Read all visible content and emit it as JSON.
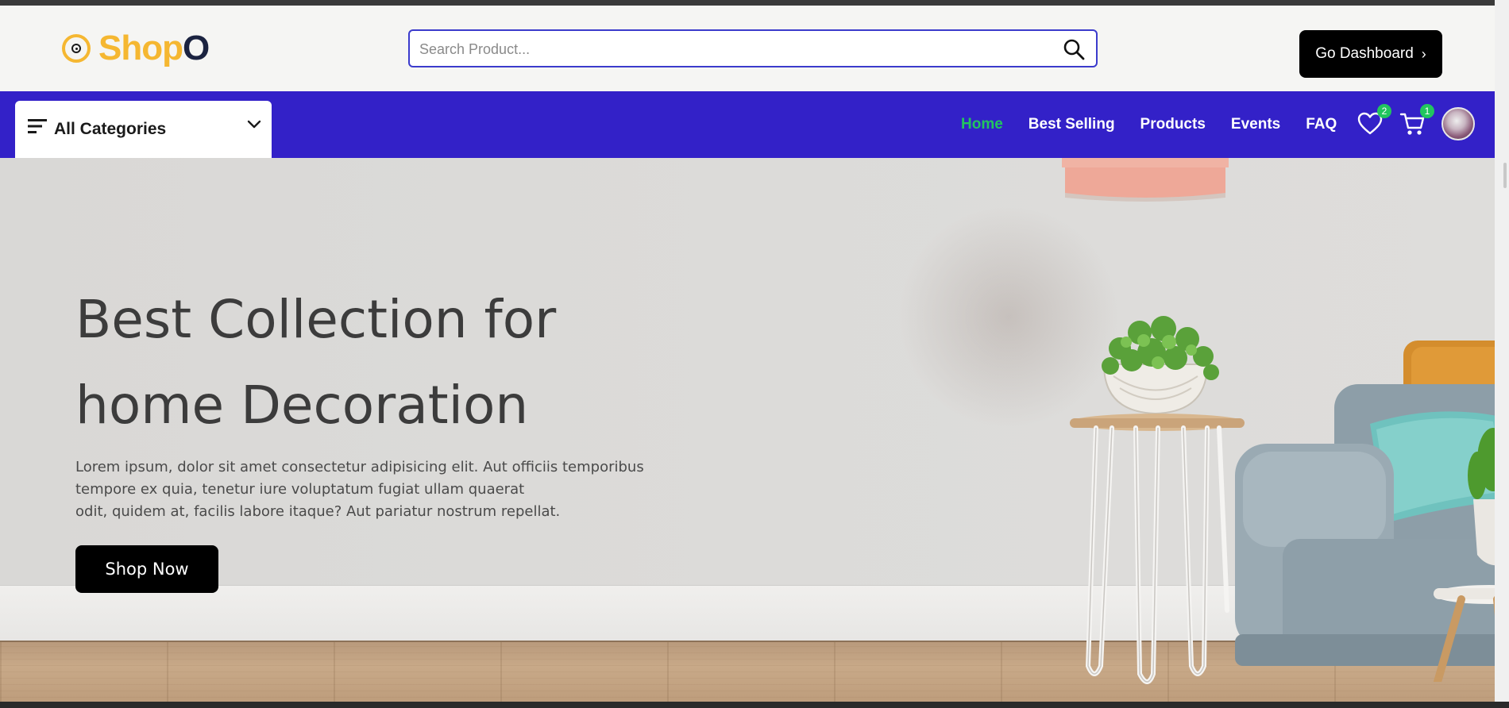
{
  "brand": {
    "name_part1": "Shop",
    "name_part2": "O"
  },
  "search": {
    "placeholder": "Search Product..."
  },
  "header": {
    "dashboard_label": "Go Dashboard"
  },
  "categories": {
    "label": "All Categories"
  },
  "nav": {
    "items": [
      {
        "label": "Home",
        "active": true
      },
      {
        "label": "Best Selling",
        "active": false
      },
      {
        "label": "Products",
        "active": false
      },
      {
        "label": "Events",
        "active": false
      },
      {
        "label": "FAQ",
        "active": false
      }
    ],
    "wishlist_count": "2",
    "cart_count": "1"
  },
  "hero": {
    "title_line1": "Best Collection for",
    "title_line2": "home Decoration",
    "desc_line1": "Lorem ipsum, dolor sit amet consectetur adipisicing elit. Aut officiis temporibus",
    "desc_line2": "tempore ex quia, tenetur iure voluptatum fugiat ullam quaerat",
    "desc_line3": "odit, quidem at, facilis labore itaque? Aut pariatur nostrum repellat.",
    "cta_label": "Shop Now"
  },
  "colors": {
    "brand_yellow": "#f5b731",
    "brand_dark": "#1b2340",
    "nav_bg": "#3321c8",
    "active_link": "#22c55e",
    "search_border": "#3b3bcc",
    "button_bg": "#000000"
  }
}
